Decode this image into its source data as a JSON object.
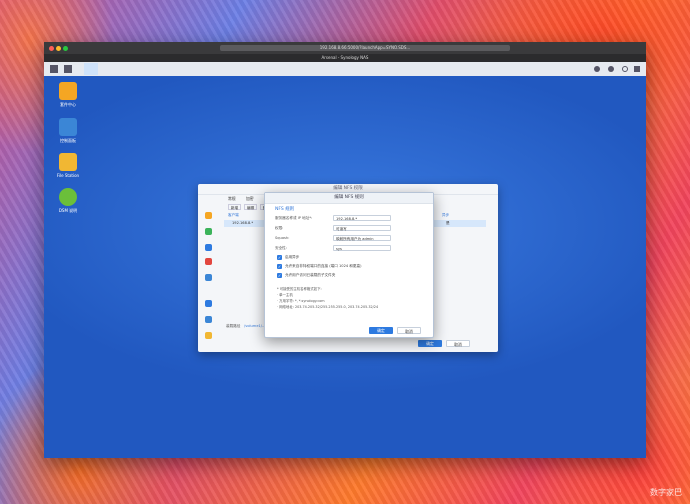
{
  "browser": {
    "url": "192.168.8.66:5000/?launchApp=SYNO.SDS...",
    "tab_title": "Arsenal - Synology NAS"
  },
  "desktop_icons": [
    {
      "label": "套件中心",
      "color": "#f5a623"
    },
    {
      "label": "控制面板",
      "color": "#3b86d6"
    },
    {
      "label": "File Station",
      "color": "#f1b733"
    },
    {
      "label": "DSM 说明",
      "color": "#6bbf3a"
    }
  ],
  "panel": {
    "title": "编辑 NFS 权限",
    "tabs": [
      "常规",
      "加密",
      "高级"
    ],
    "toolbar": [
      "新增",
      "编辑",
      "删除"
    ],
    "list_header": "客户端",
    "list_item": "192.168.8.*",
    "right_header": "异步",
    "right_value": "是",
    "path_label": "装载路径",
    "path_value": "/volume1/...",
    "ok": "确定",
    "cancel": "取消"
  },
  "dialog": {
    "title": "编辑 NFS 规则",
    "section": "NFS 规则",
    "fields": [
      {
        "label": "服务器名称或 IP 地址*:",
        "value": "192.168.8.*"
      },
      {
        "label": "权限:",
        "value": "可读写"
      },
      {
        "label": "Squash:",
        "value": "映射所有用户为 admin"
      },
      {
        "label": "安全性:",
        "value": "sys"
      }
    ],
    "checks": [
      "启用异步",
      "允许来自非特权端口的连接 (端口 1024 和更高)",
      "允许用户访问已装载的子文件夹"
    ],
    "notes": [
      "* 可接受的主机名称格式如下:",
      "· 单一主机",
      "· 万用字符: *, *.synology.com",
      "· 网络地址: 203.74.205.32/255.255.255.0, 203.74.205.32/24"
    ],
    "ok": "确定",
    "cancel": "取消"
  },
  "watermark": "数字家巴"
}
